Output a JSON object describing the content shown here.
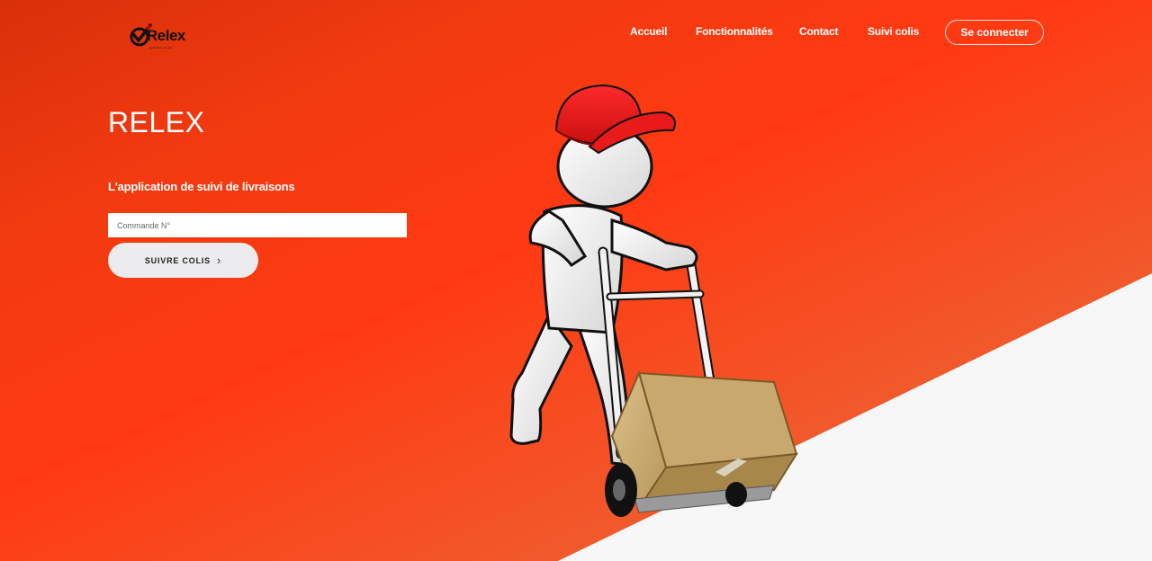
{
  "brand": {
    "logo_text": "Relex",
    "logo_tagline": "application de suivi"
  },
  "nav": {
    "links": [
      "Accueil",
      "Fonctionnalités",
      "Contact",
      "Suivi colis"
    ],
    "login_label": "Se connecter"
  },
  "hero": {
    "title": "RELEX",
    "subtitle": "L'application de suivi de livraisons",
    "order_placeholder": "Commande N°",
    "track_label": "SUIVRE COLIS"
  },
  "colors": {
    "primary": "#ff3a12",
    "button_bg": "#ececee",
    "diagonal": "#f7f7f7"
  },
  "icons": [
    "check-logo-icon",
    "chevron-right-icon"
  ]
}
